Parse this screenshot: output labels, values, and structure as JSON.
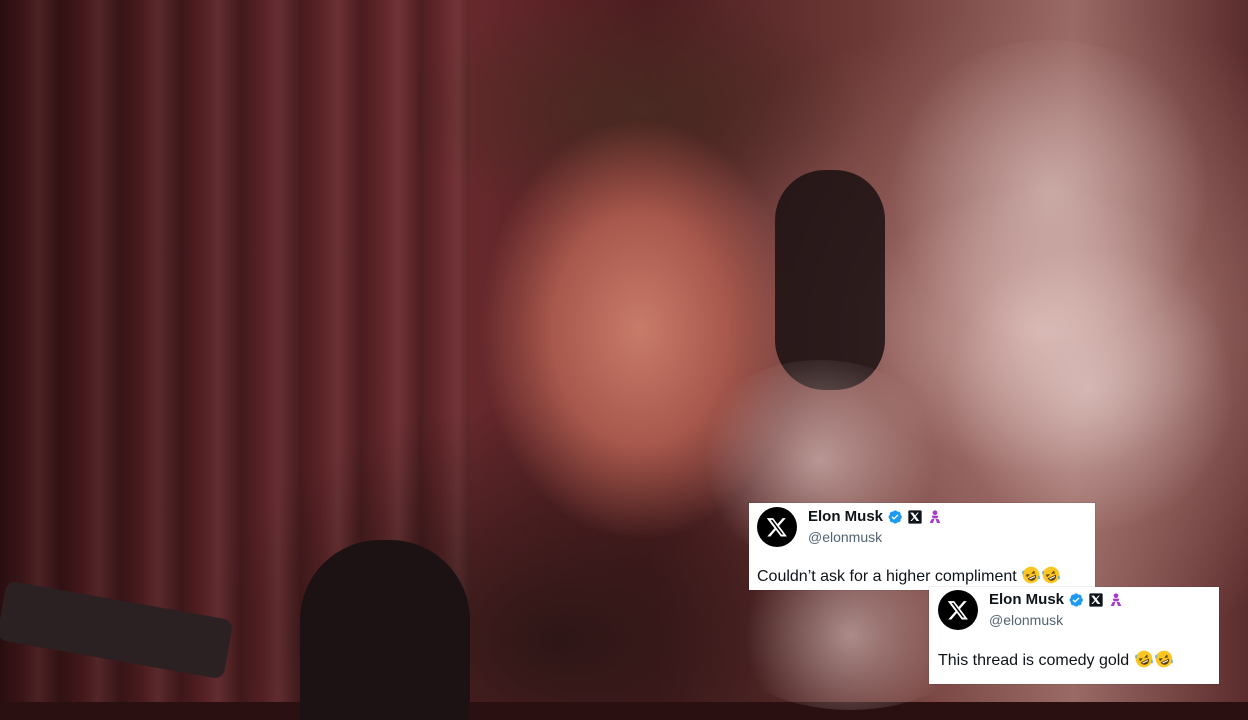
{
  "tweets": [
    {
      "display_name": "Elon Musk",
      "handle": "@elonmusk",
      "text": "Couldn’t ask for a higher compliment",
      "emoji": [
        "rolling-on-floor-laughing",
        "rolling-on-floor-laughing"
      ],
      "badges": [
        "verified-badge",
        "x-affiliate-badge",
        "purple-person-badge"
      ]
    },
    {
      "display_name": "Elon Musk",
      "handle": "@elonmusk",
      "text": "This thread is comedy gold",
      "emoji": [
        "rolling-on-floor-laughing",
        "rolling-on-floor-laughing"
      ],
      "badges": [
        "verified-badge",
        "x-affiliate-badge",
        "purple-person-badge"
      ]
    }
  ],
  "colors": {
    "verified_blue": "#1d9bf0",
    "badge_purple": "#a63ac9",
    "handle_gray": "#536471",
    "text": "#0f1419"
  }
}
